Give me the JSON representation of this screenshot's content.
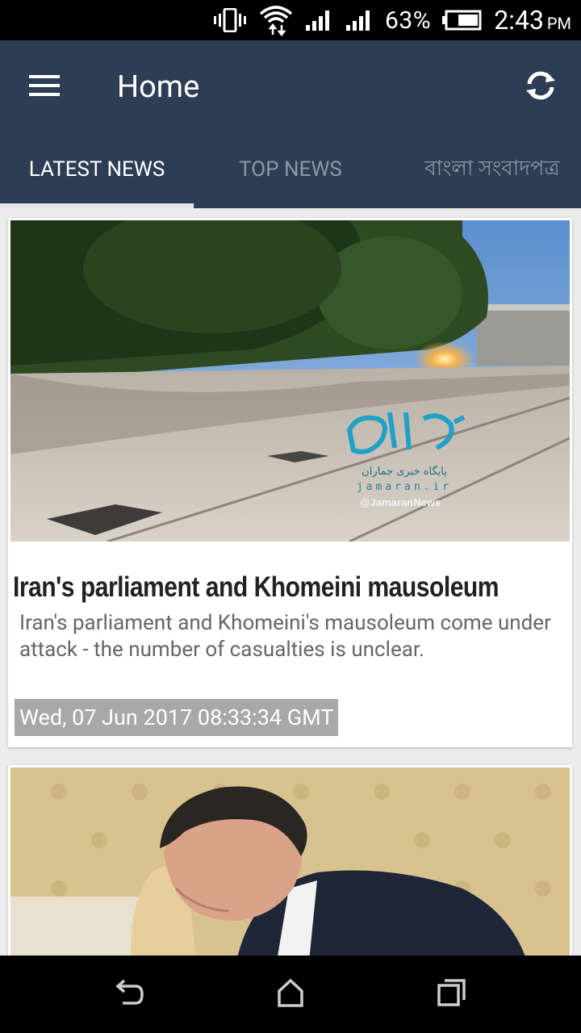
{
  "status_bar": {
    "battery_percent": "63%",
    "time": "2:43",
    "time_suffix": "PM",
    "icons": [
      "vibrate-icon",
      "wifi-icon",
      "signal-icon",
      "signal-icon",
      "battery-icon"
    ]
  },
  "app_bar": {
    "title": "Home",
    "menu_icon": "hamburger-menu-icon",
    "refresh_icon": "refresh-icon"
  },
  "tabs": [
    {
      "label": "LATEST NEWS",
      "active": true
    },
    {
      "label": "TOP NEWS",
      "active": false
    },
    {
      "label": "বাংলা সংবাদপত্র",
      "active": false
    }
  ],
  "articles": [
    {
      "title": "Iran's parliament and Khomeini mausoleum",
      "summary": "Iran's parliament and Khomeini's mausoleum come under attack - the number of casualties is unclear.",
      "date": "Wed, 07 Jun 2017 08:33:34 GMT",
      "image_watermark": {
        "site": "jamaran.ir",
        "handle": "@JamaranNews",
        "persian": "پایگاه خبری جماران"
      }
    },
    {
      "title": "",
      "summary": "",
      "date": ""
    }
  ],
  "nav_bar": {
    "icons": [
      "back-icon",
      "home-icon",
      "recents-icon"
    ]
  },
  "colors": {
    "app_bar": "#2d3e54",
    "status_bar": "#000000",
    "tab_inactive": "#8a97a8",
    "date_badge": "#a8a8a8"
  }
}
